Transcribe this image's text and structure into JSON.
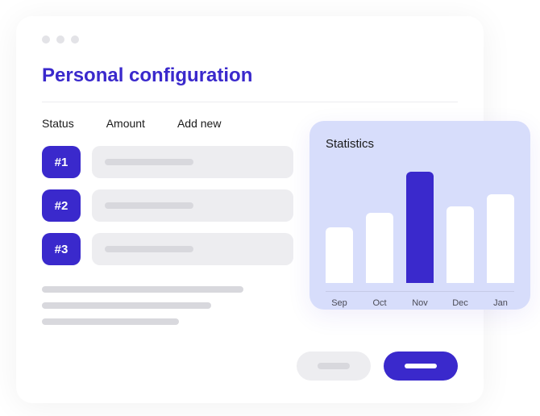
{
  "window": {
    "title": "Personal configuration"
  },
  "columns": {
    "status": "Status",
    "amount": "Amount",
    "add_new": "Add new"
  },
  "rows": [
    {
      "badge": "#1"
    },
    {
      "badge": "#2"
    },
    {
      "badge": "#3"
    }
  ],
  "stats": {
    "title": "Statistics"
  },
  "chart_data": {
    "type": "bar",
    "title": "Statistics",
    "categories": [
      "Sep",
      "Oct",
      "Nov",
      "Dec",
      "Jan"
    ],
    "values": [
      60,
      75,
      120,
      82,
      95
    ],
    "ylim": [
      0,
      130
    ],
    "highlight_index": 2
  },
  "colors": {
    "accent": "#3a29cc",
    "panel": "#d7ddfb",
    "muted": "#ededf0"
  }
}
